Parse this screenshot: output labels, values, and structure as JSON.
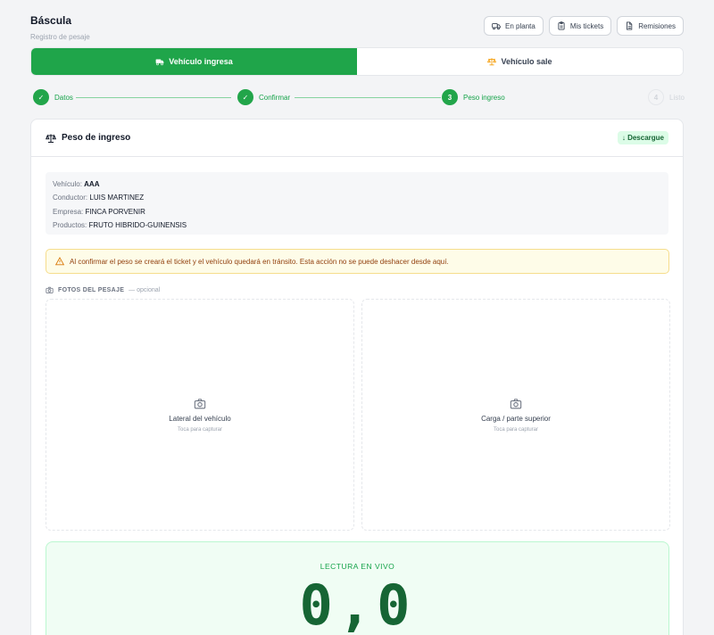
{
  "header": {
    "title": "Báscula",
    "subtitle": "Registro de pesaje"
  },
  "top_buttons": [
    {
      "label": "En planta",
      "icon": "truck-icon"
    },
    {
      "label": "Mis tickets",
      "icon": "clipboard-icon"
    },
    {
      "label": "Remisiones",
      "icon": "document-icon"
    }
  ],
  "mode_toggle": {
    "active_label": "Vehículo ingresa",
    "inactive_label": "Vehículo sale"
  },
  "stepper": {
    "steps": [
      {
        "label": "Datos",
        "marker": "✓",
        "state": "done"
      },
      {
        "label": "Confirmar",
        "marker": "✓",
        "state": "done"
      },
      {
        "label": "Peso ingreso",
        "marker": "3",
        "state": "current"
      },
      {
        "label": "Listo",
        "marker": "4",
        "state": "future"
      }
    ]
  },
  "card": {
    "title": "Peso de ingreso",
    "badge": "↓ Descargue",
    "info": {
      "vehicle_label": "Vehículo:",
      "vehicle_value": "AAA",
      "driver_label": "Conductor:",
      "driver_value": "LUIS MARTINEZ",
      "company_label": "Empresa:",
      "company_value": "FINCA PORVENIR",
      "products_label": "Productos:",
      "products_value": "FRUTO HIBRIDO-GUINENSIS"
    },
    "warning": "Al confirmar el peso se creará el ticket y el vehículo quedará en tránsito. Esta acción no se puede deshacer desde aquí.",
    "photos": {
      "label": "FOTOS DEL PESAJE",
      "optional": "— opcional",
      "slots": [
        {
          "label": "Lateral del vehículo",
          "hint": "Toca para capturar"
        },
        {
          "label": "Carga / parte superior",
          "hint": "Toca para capturar"
        }
      ]
    },
    "live": {
      "label": "LECTURA EN VIVO",
      "value": "0,0"
    }
  },
  "colors": {
    "accent": "#1fa54a",
    "warning_bg": "#fefce8",
    "live_bg": "#f0fdf4",
    "live_text": "#166534"
  }
}
